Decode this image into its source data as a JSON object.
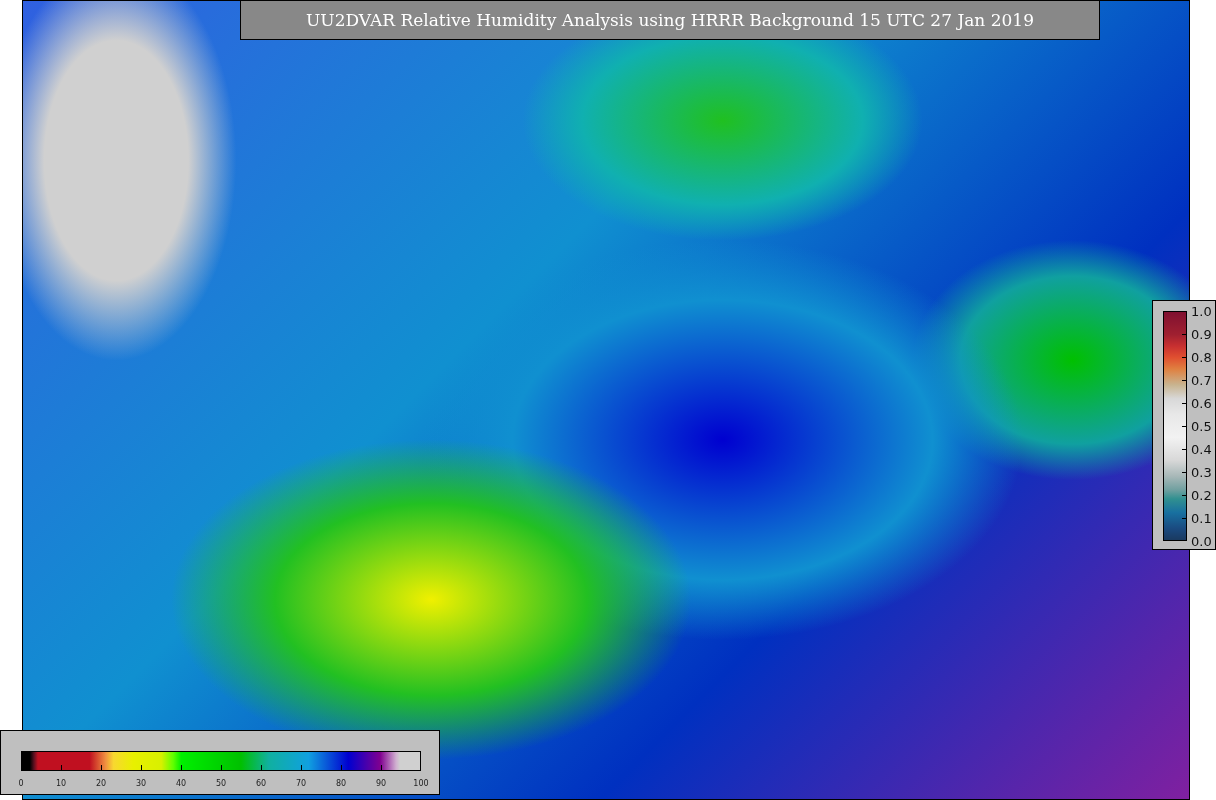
{
  "title": "UU2DVAR Relative Humidity Analysis using HRRR Background 15 UTC 27 Jan 2019",
  "humidity_colorbar": {
    "ticks": [
      "0",
      "10",
      "20",
      "30",
      "40",
      "50",
      "60",
      "70",
      "80",
      "90",
      "100"
    ]
  },
  "ratio_colorbar": {
    "ticks": [
      "1.0",
      "0.9",
      "0.8",
      "0.7",
      "0.6",
      "0.5",
      "0.4",
      "0.3",
      "0.2",
      "0.1",
      "0.0"
    ]
  }
}
